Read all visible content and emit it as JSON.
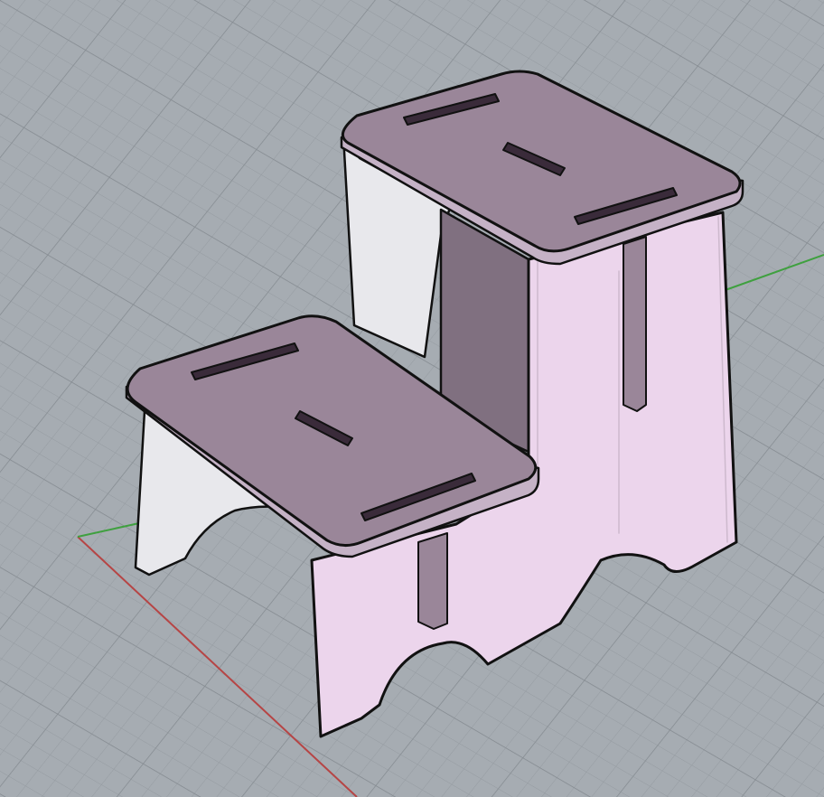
{
  "viewport": {
    "background": "#a6acb2",
    "grid_minor_color": "#9aa0a6",
    "grid_major_color": "#8a9097",
    "x_axis_color": "#b64545",
    "y_axis_color": "#3fa03f"
  },
  "model": {
    "object": "step-stool",
    "colors": {
      "top_surface": "#9a8699",
      "top_edge": "#c5b2c6",
      "side_panel": "#ecd5ec",
      "inner_panel": "#e8e8ec",
      "back_dark": "#807080",
      "slot": "#2a1f2a",
      "outline": "#111111"
    }
  },
  "icons": [
    "world-axis-x-icon",
    "world-axis-y-icon"
  ]
}
